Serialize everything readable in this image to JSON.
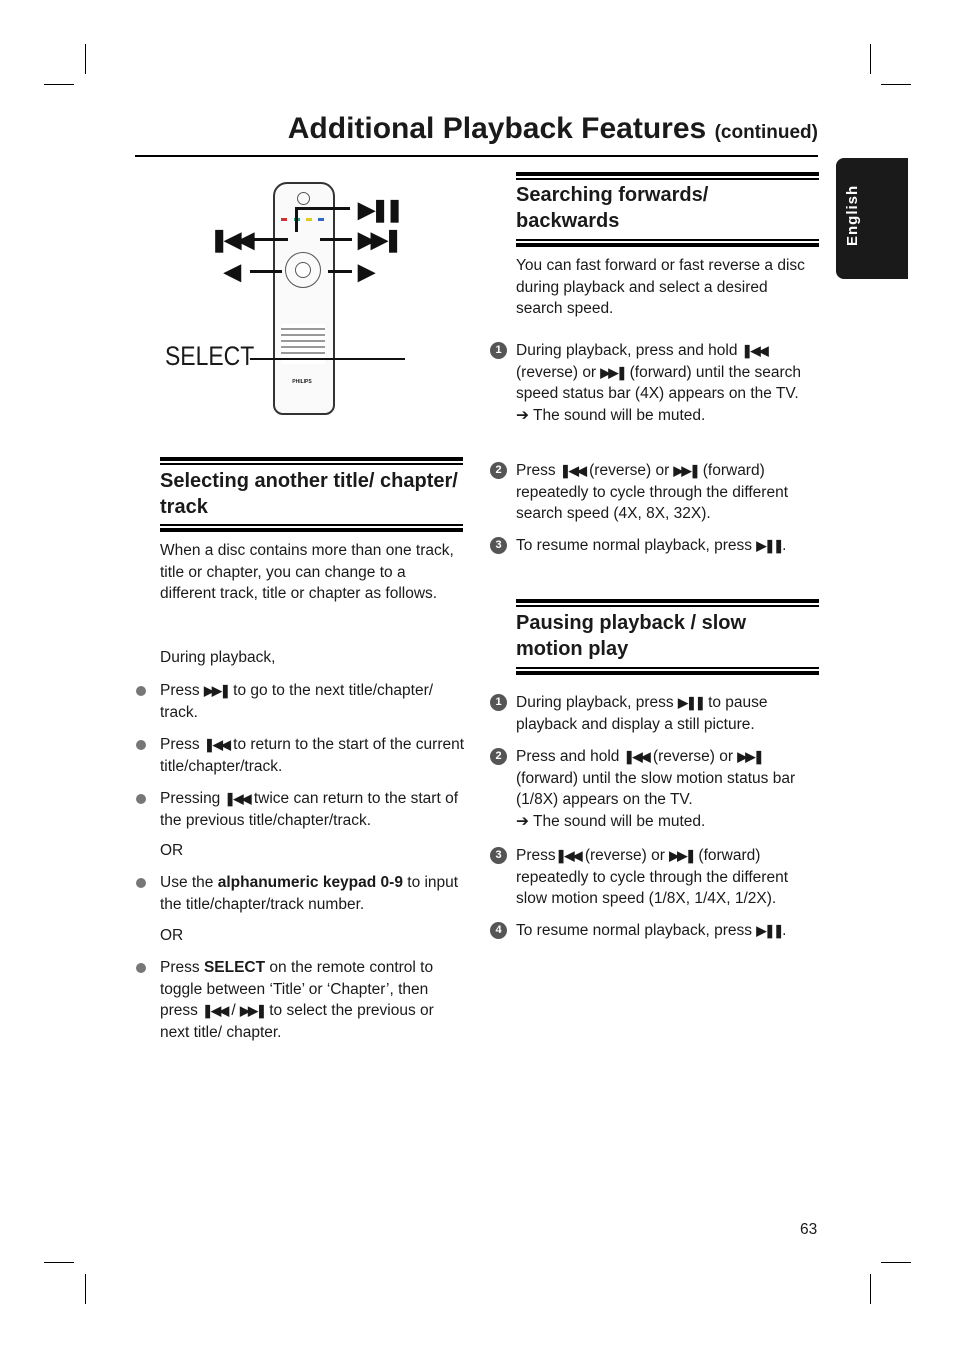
{
  "header": {
    "title": "Additional Playback Features",
    "continued": "(continued)"
  },
  "side_tab": {
    "language": "English"
  },
  "figure": {
    "select_label": "SELECT",
    "brand": "PHILIPS",
    "icons": [
      "play-pause-icon",
      "previous-icon",
      "next-icon",
      "left-arrow-icon",
      "right-arrow-icon"
    ]
  },
  "left": {
    "heading": "Selecting another title/ chapter/ track",
    "intro": "When a disc contains more than one track, title or chapter, you can change to a different track, title or chapter as follows.",
    "during": "During playback,",
    "bullets": [
      [
        {
          "t": "Press "
        },
        {
          "i": "next"
        },
        {
          "t": " to go to the next title/chapter/ track."
        }
      ],
      [
        {
          "t": "Press "
        },
        {
          "i": "prev"
        },
        {
          "t": "  to return to the start of the current title/chapter/track."
        }
      ],
      [
        {
          "t": "Pressing "
        },
        {
          "i": "prev"
        },
        {
          "t": "  twice can return to the start of the previous title/chapter/track."
        }
      ],
      [
        {
          "t": "Use the "
        },
        {
          "b": "alphanumeric keypad 0-9"
        },
        {
          "t": " to input the title/chapter/track number."
        }
      ],
      [
        {
          "t": "Press "
        },
        {
          "b": "SELECT"
        },
        {
          "t": " on the remote control to toggle between ‘Title’ or ‘Chapter’, then press "
        },
        {
          "i": "prev"
        },
        {
          "t": " / "
        },
        {
          "i": "next"
        },
        {
          "t": " to select the previous or next title/ chapter."
        }
      ]
    ],
    "or1": "OR",
    "or2": "OR"
  },
  "right": {
    "search_heading": "Searching forwards/ backwards",
    "search_intro": "You can fast forward or fast reverse a disc during playback and select a desired search speed.",
    "search_steps": [
      [
        {
          "t": "During playback, press and hold "
        },
        {
          "i": "prev"
        },
        {
          "t": " (reverse) or "
        },
        {
          "i": "next"
        },
        {
          "t": " (forward) until the search speed status bar (4X) appears on the TV."
        },
        {
          "br": 1
        },
        {
          "t": "➔ The sound will be muted."
        }
      ],
      [
        {
          "t": "Press "
        },
        {
          "i": "prev"
        },
        {
          "t": "  (reverse) or "
        },
        {
          "i": "next"
        },
        {
          "t": " (forward) repeatedly to cycle through the different search speed (4X, 8X, 32X)."
        }
      ],
      [
        {
          "t": "To resume normal playback, press "
        },
        {
          "i": "play"
        },
        {
          "t": "."
        }
      ]
    ],
    "pause_heading": "Pausing playback / slow motion play",
    "pause_steps": [
      [
        {
          "t": "During playback, press "
        },
        {
          "i": "play"
        },
        {
          "t": " to pause playback and display a still picture."
        }
      ],
      [
        {
          "t": "Press and hold "
        },
        {
          "i": "prev"
        },
        {
          "t": "  (reverse) or "
        },
        {
          "i": "next"
        },
        {
          "t": " (forward) until the slow motion status bar (1/8X) appears on the TV."
        },
        {
          "br": 1
        },
        {
          "t": "➔ The sound will be muted."
        }
      ],
      [
        {
          "t": "Press"
        },
        {
          "i": "prev"
        },
        {
          "t": "  (reverse) or "
        },
        {
          "i": "next"
        },
        {
          "t": " (forward) repeatedly to cycle through the different slow motion speed (1/8X, 1/4X, 1/2X)."
        }
      ],
      [
        {
          "t": "To resume normal playback, press "
        },
        {
          "i": "play"
        },
        {
          "t": "."
        }
      ]
    ],
    "step_numbers": [
      "1",
      "2",
      "3",
      "4"
    ]
  },
  "footer": {
    "page_number": "63"
  }
}
